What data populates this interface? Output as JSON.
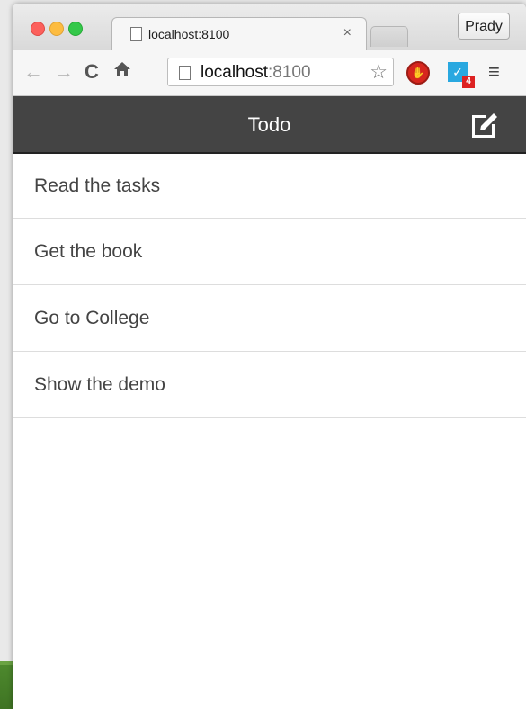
{
  "browser": {
    "tab_title": "localhost:8100",
    "tab_close": "×",
    "profile_name": "Prady",
    "url_host": "localhost",
    "url_port": ":8100",
    "ext_badge": "4"
  },
  "app": {
    "title": "Todo",
    "header_color": "#444444"
  },
  "todos": [
    {
      "label": "Read the tasks"
    },
    {
      "label": "Get the book"
    },
    {
      "label": "Go to College"
    },
    {
      "label": "Show the demo"
    }
  ]
}
